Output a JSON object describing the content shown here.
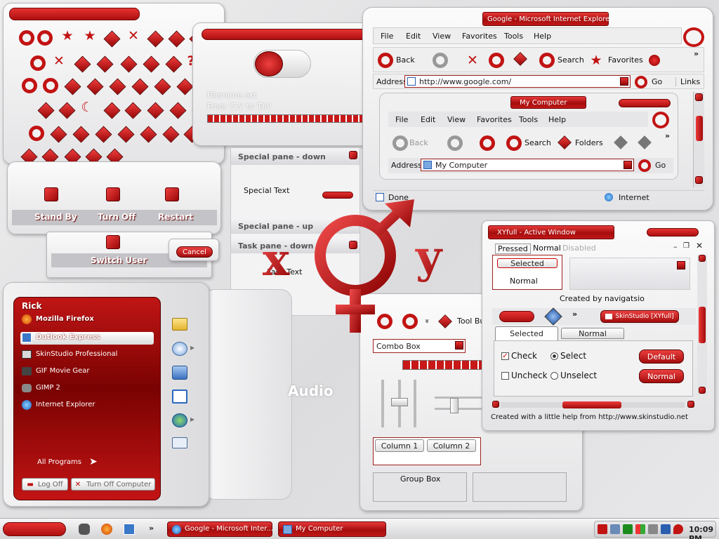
{
  "ie": {
    "title": "Google - Microsoft Internet Explorer",
    "menu": [
      "File",
      "Edit",
      "View",
      "Favorites",
      "Tools",
      "Help"
    ],
    "back": "Back",
    "search": "Search",
    "favorites": "Favorites",
    "address_label": "Address",
    "address": "http://www.google.com/",
    "go": "Go",
    "links": "Links",
    "done": "Done",
    "zone": "Internet",
    "chevron": "»"
  },
  "explorer": {
    "title": "My Computer",
    "menu": [
      "File",
      "Edit",
      "View",
      "Favorites",
      "Tools",
      "Help"
    ],
    "back": "Back",
    "search": "Search",
    "folders": "Folders",
    "address_label": "Address",
    "address": "My Computer",
    "go": "Go",
    "chevron": "»"
  },
  "progress_panel": {
    "filename": "Filename.ext",
    "from": "From 'C:\\' to 'D:\\'"
  },
  "task_panes": {
    "down_title": "Special pane - down",
    "special_text": "Special Text",
    "up_title": "Special pane - up",
    "task_down_title": "Task pane - down",
    "task_text": "Task Text"
  },
  "shutdown": {
    "stand_by": "Stand By",
    "turn_off": "Turn Off",
    "restart": "Restart",
    "switch_user": "Switch User",
    "cancel": "Cancel"
  },
  "start_menu": {
    "user": "Rick",
    "items": [
      "Mozilla Firefox",
      "Outlook Express",
      "SkinStudio Professional",
      "GIF Movie Gear",
      "GIMP 2",
      "Internet Explorer"
    ],
    "all_programs": "All Programs",
    "log_off": "Log Off",
    "turn_off": "Turn Off Computer"
  },
  "audio_label": "Audio",
  "logo": {
    "x": "x",
    "y": "y"
  },
  "controls": {
    "toolbar": "Tool Bu",
    "combo": "Combo Box",
    "col1": "Column 1",
    "col2": "Column 2",
    "groupbox": "Group Box",
    "chevron": "»"
  },
  "xyfull": {
    "title": "XYfull - Active Window",
    "tabs": [
      "Pressed",
      "Normal",
      "Disabled"
    ],
    "selected": "Selected",
    "normal": "Normal",
    "created_by": "Created by navigatsio",
    "skinstudio": "SkinStudio [XYfull]",
    "tab_selected": "Selected",
    "tab_normal": "Normal",
    "check": "Check",
    "select": "Select",
    "uncheck": "Uncheck",
    "unselect": "Unselect",
    "default_btn": "Default",
    "normal_btn": "Normal",
    "footer": "Created with a little help from http://www.skinstudio.net",
    "chevron": "»"
  },
  "taskbar": {
    "task1": "Google - Microsoft Inter...",
    "task2": "My Computer",
    "clock": "10:09 PM",
    "chevron": "»"
  }
}
